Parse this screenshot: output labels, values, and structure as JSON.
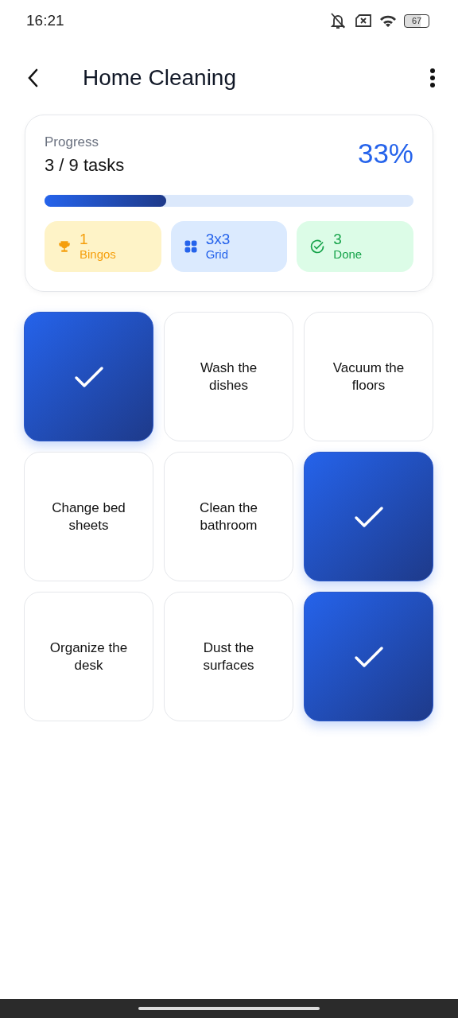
{
  "status_bar": {
    "time": "16:21",
    "battery": "67"
  },
  "header": {
    "title": "Home Cleaning"
  },
  "progress": {
    "label": "Progress",
    "count": "3 / 9 tasks",
    "percent": "33%",
    "level": 0.33
  },
  "stats": [
    {
      "kind": "bingos",
      "value": "1",
      "label": "Bingos",
      "color": "#f59e0b"
    },
    {
      "kind": "grid",
      "value": "3x3",
      "label": "Grid",
      "color": "#2563eb"
    },
    {
      "kind": "done",
      "value": "3",
      "label": "Done",
      "color": "#16a34a"
    }
  ],
  "cells": [
    {
      "checked": true
    },
    {
      "label": "Wash the dishes",
      "checked": false
    },
    {
      "label": "Vacuum the floors",
      "checked": false
    },
    {
      "label": "Change bed sheets",
      "checked": false
    },
    {
      "label": "Clean the bathroom",
      "checked": false
    },
    {
      "checked": true
    },
    {
      "label": "Organize the desk",
      "checked": false
    },
    {
      "label": "Dust the surfaces",
      "checked": false
    },
    {
      "checked": true
    }
  ]
}
